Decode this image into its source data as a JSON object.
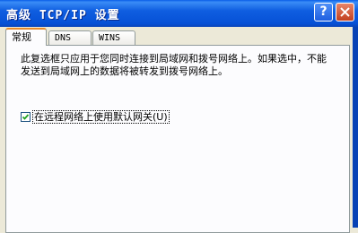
{
  "window": {
    "title": "高级 TCP/IP 设置",
    "help_glyph": "?"
  },
  "tabs": [
    {
      "label": "常规",
      "active": true
    },
    {
      "label": "DNS",
      "active": false
    },
    {
      "label": "WINS",
      "active": false
    }
  ],
  "general": {
    "description": "此复选框只应用于您同时连接到局域网和拨号网络上。如果选中，不能发送到局域网上的数据将被转发到拨号网络上。",
    "checkbox_label": "在远程网络上使用默认网关(U)",
    "checkbox_checked": true
  },
  "colors": {
    "titlebar": "#0650d6",
    "tab_highlight": "#e68b2c",
    "panel_bg": "#fcfcfe"
  }
}
